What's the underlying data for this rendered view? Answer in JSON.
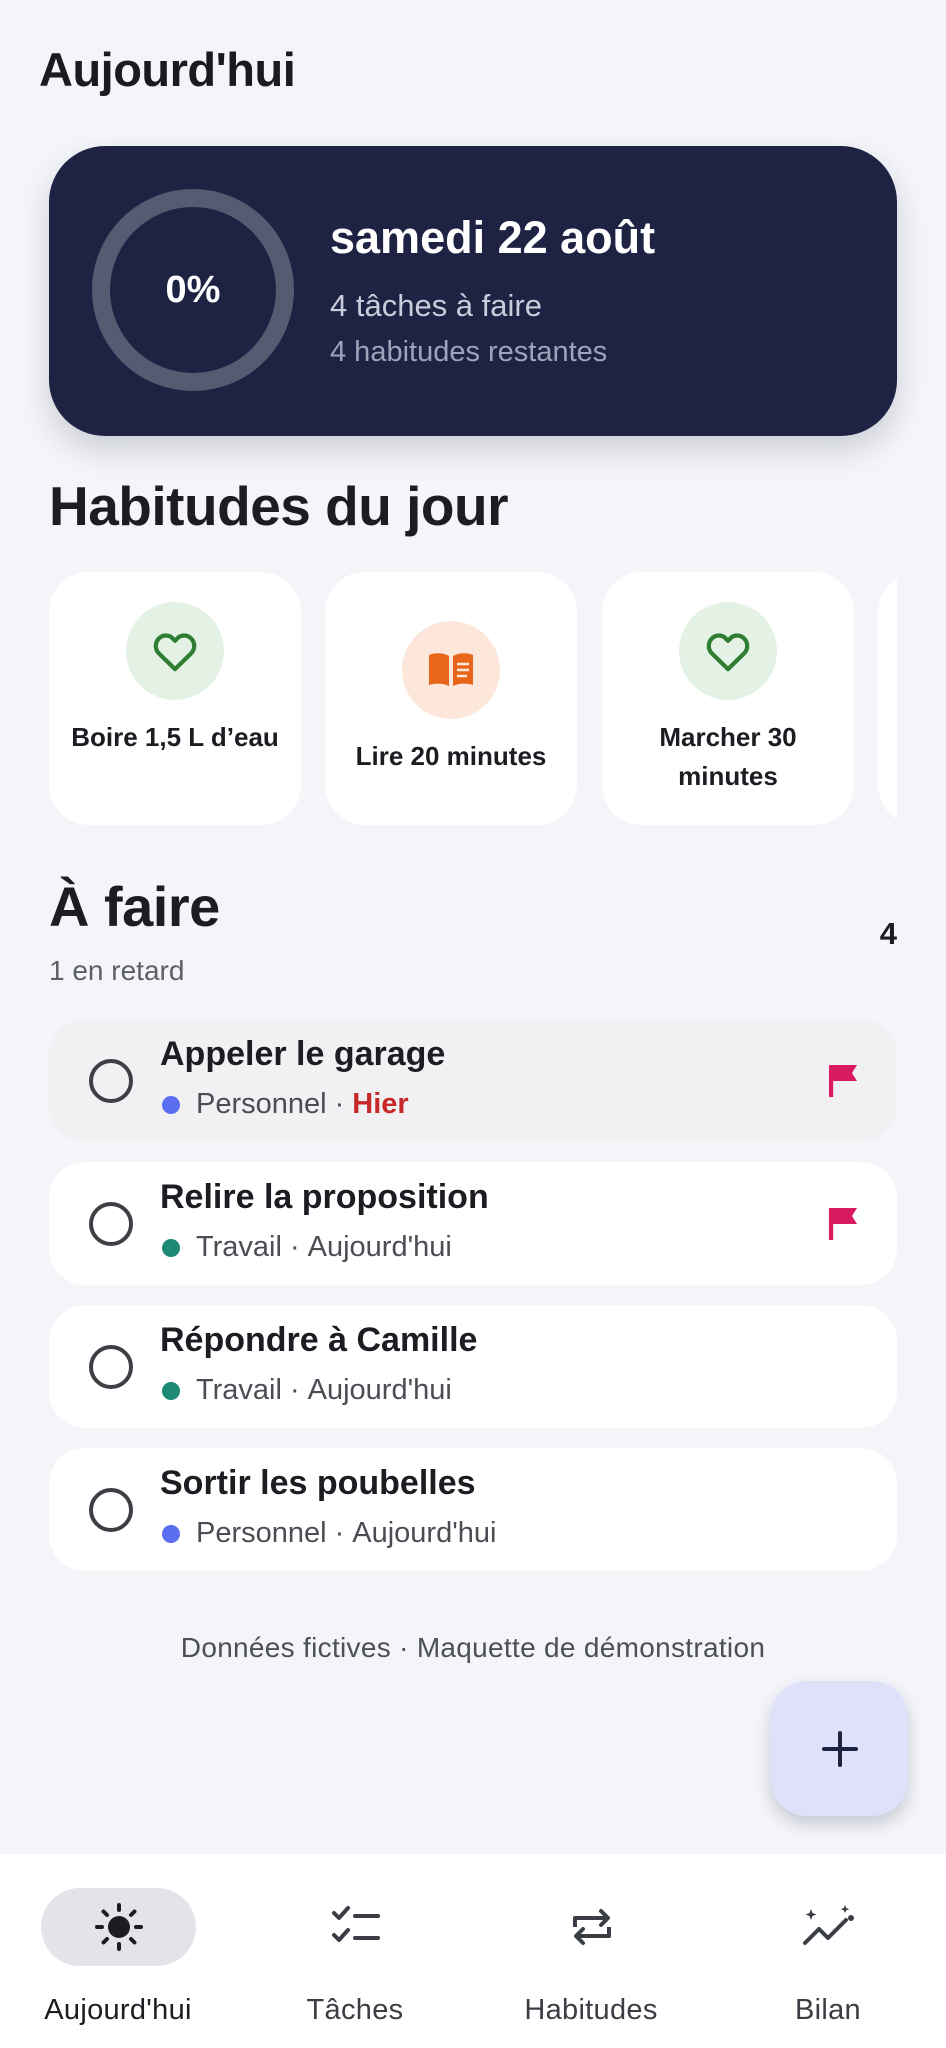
{
  "page": {
    "title": "Aujourd'hui"
  },
  "summary": {
    "progress_label": "0%",
    "progress_fraction": 0,
    "date": "samedi 22 août",
    "tasks_text": "4 tâches à faire",
    "habits_text": "4 habitudes restantes"
  },
  "habits": {
    "title": "Habitudes du jour",
    "items": [
      {
        "label": "Boire 1,5 L d’eau",
        "icon": "heart-icon",
        "color": "#2e7d32",
        "bg": "#e3f2e5"
      },
      {
        "label": "Lire 20 minutes",
        "icon": "book-icon",
        "color": "#e8651a",
        "bg": "#fde7da"
      },
      {
        "label": "Marcher 30 minutes",
        "icon": "heart-icon",
        "color": "#2e7d32",
        "bg": "#e3f2e5"
      }
    ]
  },
  "todo": {
    "title": "À faire",
    "count": "4",
    "late_text": "1 en retard",
    "tasks": [
      {
        "name": "Appeler le garage",
        "category": "Personnel",
        "separator": "·",
        "due": "Hier",
        "overdue": true,
        "flagged": true,
        "dot_color": "#5b6ef0"
      },
      {
        "name": "Relire la proposition",
        "category": "Travail",
        "separator": "·",
        "due": "Aujourd'hui",
        "overdue": false,
        "flagged": true,
        "dot_color": "#1f8a74"
      },
      {
        "name": "Répondre à Camille",
        "category": "Travail",
        "separator": "·",
        "due": "Aujourd'hui",
        "overdue": false,
        "flagged": false,
        "dot_color": "#1f8a74"
      },
      {
        "name": "Sortir les poubelles",
        "category": "Personnel",
        "separator": "·",
        "due": "Aujourd'hui",
        "overdue": false,
        "flagged": false,
        "dot_color": "#5b6ef0"
      }
    ]
  },
  "footnote": "Données fictives · Maquette de démonstration",
  "fab": {
    "icon": "plus-icon"
  },
  "nav": {
    "items": [
      {
        "label": "Aujourd'hui",
        "icon": "sun-icon",
        "active": true
      },
      {
        "label": "Tâches",
        "icon": "checklist-icon",
        "active": false
      },
      {
        "label": "Habitudes",
        "icon": "repeat-icon",
        "active": false
      },
      {
        "label": "Bilan",
        "icon": "stats-icon",
        "active": false
      }
    ]
  },
  "colors": {
    "accent": "#1e2343",
    "flag": "#d81b60",
    "overdue": "#c62828",
    "fab_bg": "#dfe1fb"
  }
}
